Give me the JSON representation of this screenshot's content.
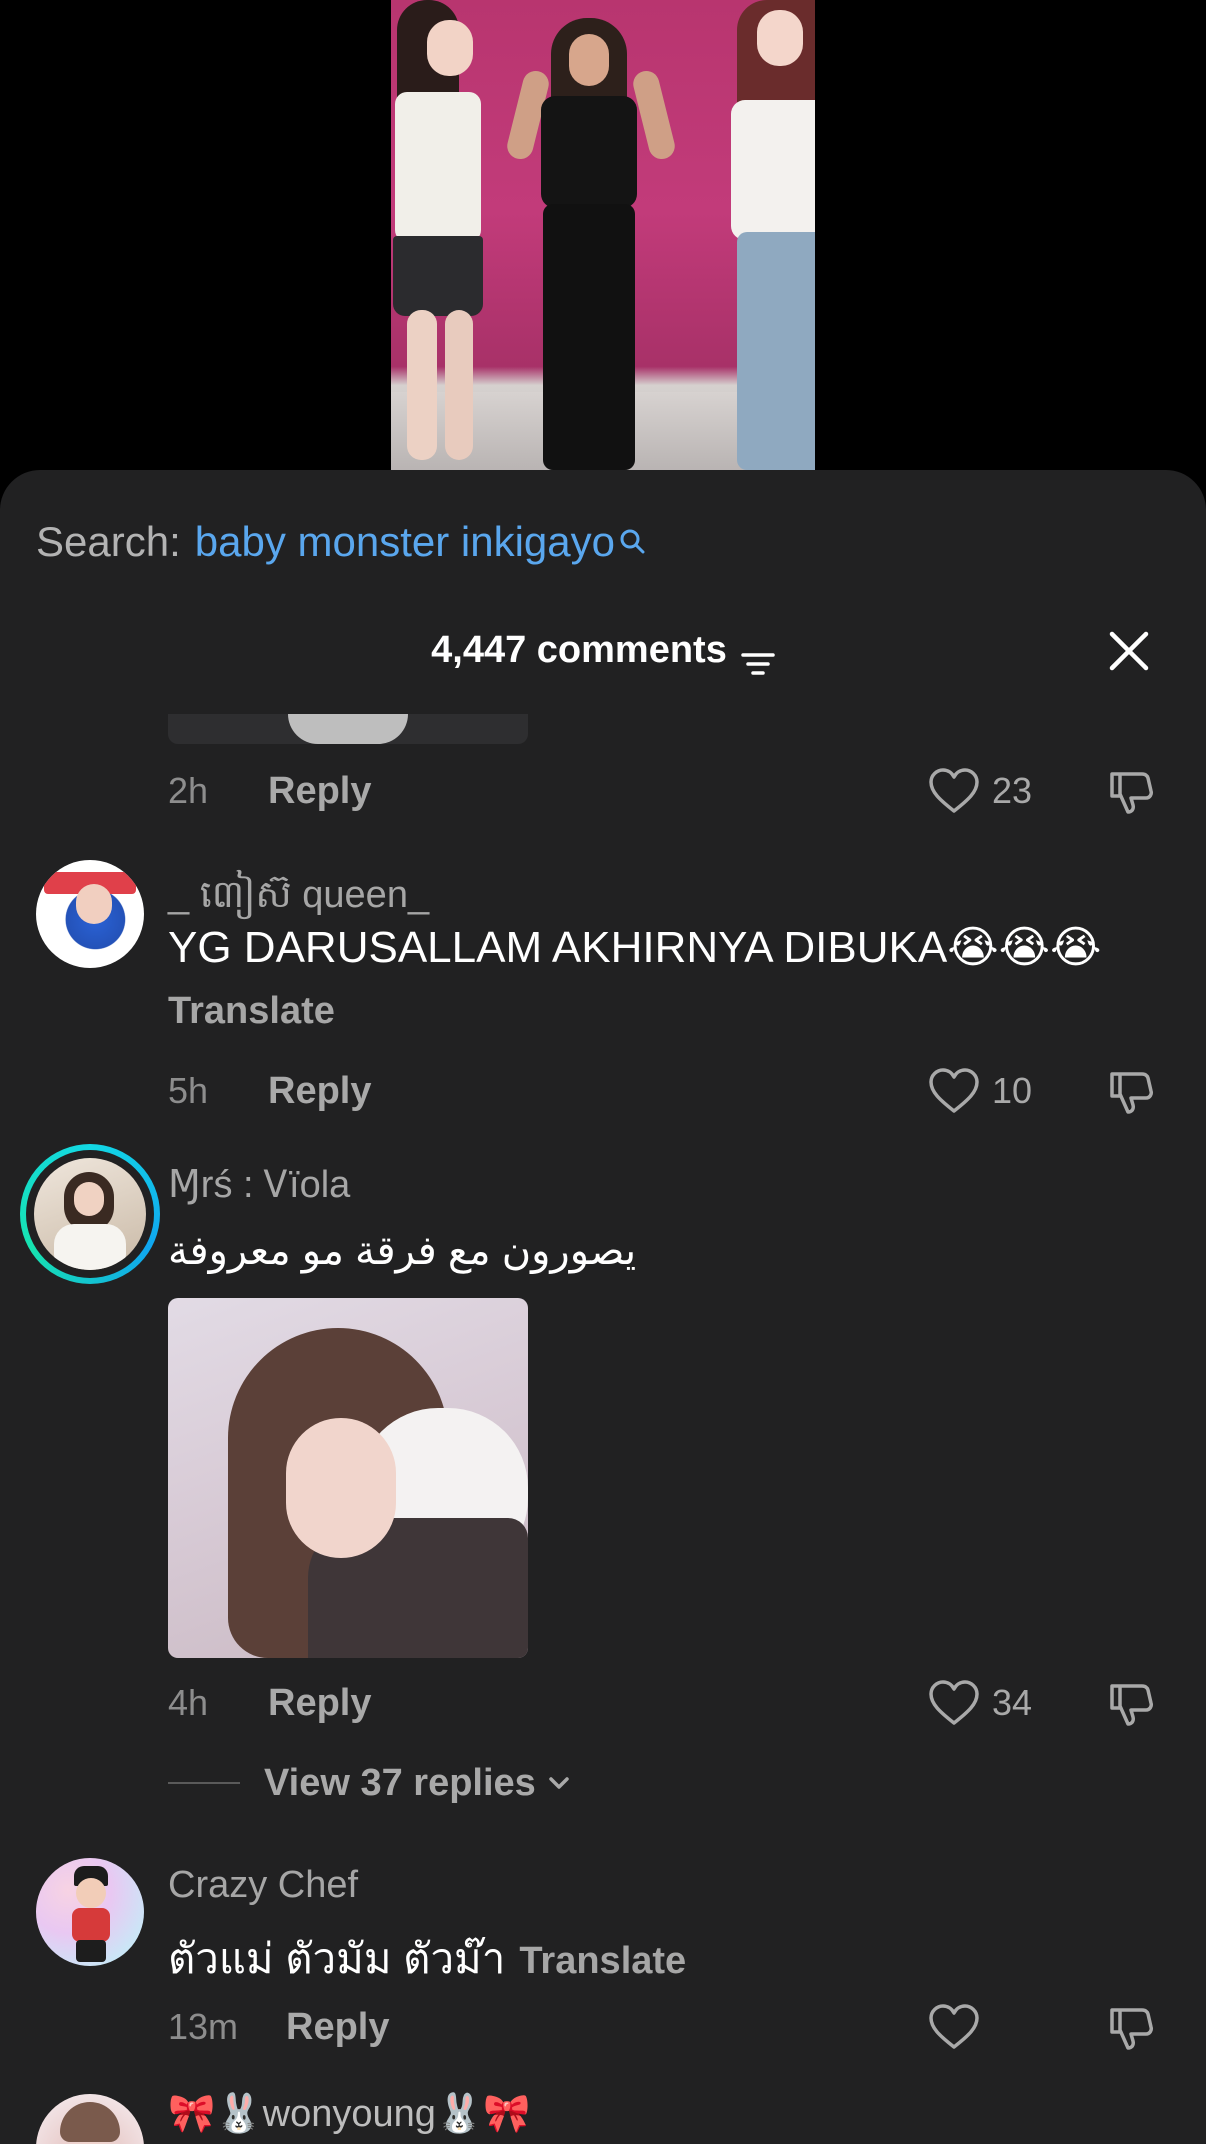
{
  "search": {
    "prefix": "Search:",
    "term": "baby monster inkigayo"
  },
  "header": {
    "comment_count": "4,447 comments"
  },
  "comments": [
    {
      "time": "2h",
      "reply_label": "Reply",
      "likes": "23"
    },
    {
      "username": "_ ៣ៀស៊ queen_",
      "text": "YG DARUSALLAM AKHIRNYA DIBUKA😭😭😭",
      "translate_label": "Translate",
      "time": "5h",
      "reply_label": "Reply",
      "likes": "10"
    },
    {
      "username": "Ɱrś : Ꮩïola",
      "text": "يصورون مع فرقة مو معروفة",
      "time": "4h",
      "reply_label": "Reply",
      "likes": "34",
      "view_replies_label": "View 37 replies"
    },
    {
      "username": "Crazy Chef",
      "text": "ตัวแม่ ตัวมัม ตัวม๊า",
      "translate_label": "Translate",
      "time": "13m",
      "reply_label": "Reply",
      "likes": ""
    },
    {
      "username": "🎀🐰wonyoung🐰🎀"
    }
  ],
  "colors": {
    "sheet_bg": "#212122",
    "search_term": "#5aa7ee",
    "muted_text": "#a6a6a6",
    "story_ring": "#13d8e4"
  },
  "icons": {
    "search": "search-icon",
    "filter": "filter-icon",
    "close": "close-icon",
    "like": "heart-outline-icon",
    "dislike": "thumbs-down-icon",
    "chevron": "chevron-down-icon"
  }
}
